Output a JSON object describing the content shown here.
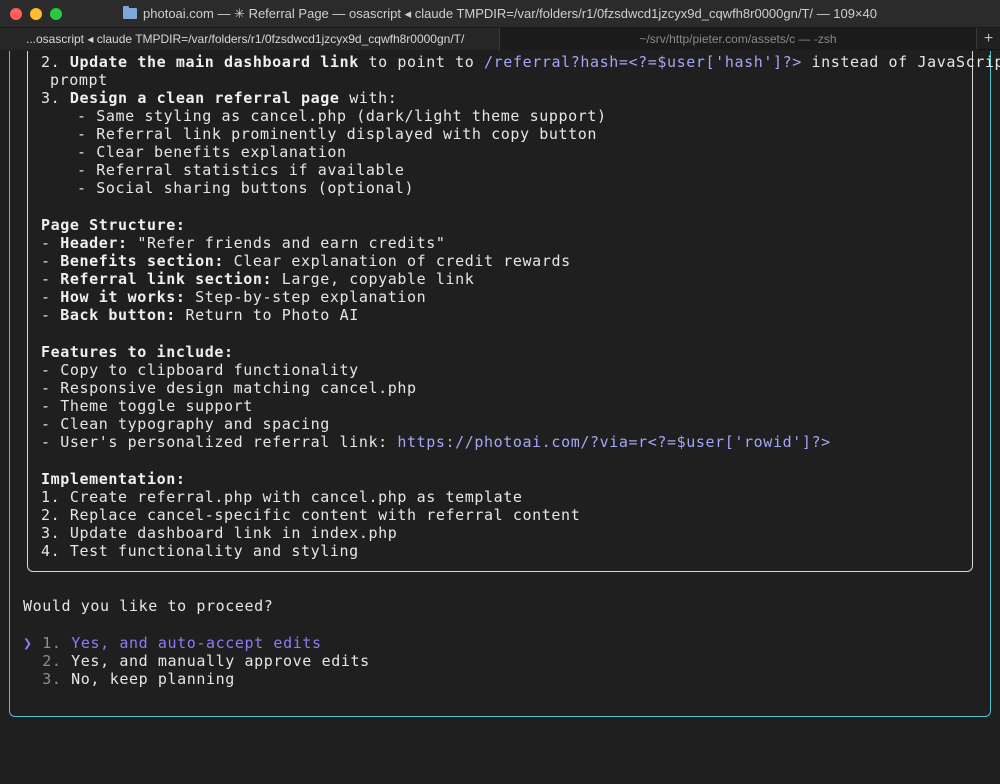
{
  "window": {
    "title": "photoai.com — ✳ Referral Page — osascript ◂ claude TMPDIR=/var/folders/r1/0fzsdwcd1jzcyx9d_cqwfh8r0000gn/T/ — 109×40"
  },
  "tabs": [
    {
      "label": "...osascript ◂ claude TMPDIR=/var/folders/r1/0fzsdwcd1jzcyx9d_cqwfh8r0000gn/T/"
    },
    {
      "label": "~/srv/http/pieter.com/assets/c — -zsh"
    }
  ],
  "tab_add_label": "+",
  "plan": {
    "step2_num": "2. ",
    "step2_bold": "Update the main dashboard link",
    "step2_mid": " to point to ",
    "step2_code": "/referral?hash=<?=$user['hash']?>",
    "step2_end": " instead of JavaScript",
    "step2_cont": "prompt",
    "step3_num": "3. ",
    "step3_bold": "Design a clean referral page",
    "step3_end": " with:",
    "step3_items": [
      "- Same styling as cancel.php (dark/light theme support)",
      "- Referral link prominently displayed with copy button",
      "- Clear benefits explanation",
      "- Referral statistics if available",
      "- Social sharing buttons (optional)"
    ],
    "structure_heading": "Page Structure:",
    "structure": [
      {
        "label": "Header:",
        "text": " \"Refer friends and earn credits\""
      },
      {
        "label": "Benefits section:",
        "text": " Clear explanation of credit rewards"
      },
      {
        "label": "Referral link section:",
        "text": " Large, copyable link"
      },
      {
        "label": "How it works:",
        "text": " Step-by-step explanation"
      },
      {
        "label": "Back button:",
        "text": " Return to Photo AI"
      }
    ],
    "features_heading": "Features to include:",
    "features": [
      "- Copy to clipboard functionality",
      "- Responsive design matching cancel.php",
      "- Theme toggle support",
      "- Clean typography and spacing"
    ],
    "features_last_text": "- User's personalized referral link: ",
    "features_last_code": "https://photoai.com/?via=r<?=$user['rowid']?>",
    "impl_heading": "Implementation:",
    "impl": [
      "1. Create referral.php with cancel.php as template",
      "2. Replace cancel-specific content with referral content",
      "3. Update dashboard link in index.php",
      "4. Test functionality and styling"
    ]
  },
  "prompt": {
    "question": "Would you like to proceed?",
    "pointer": "❯",
    "options": [
      {
        "num": "1.",
        "label": "Yes, and auto-accept edits"
      },
      {
        "num": "2.",
        "label": "Yes, and manually approve edits"
      },
      {
        "num": "3.",
        "label": "No, keep planning"
      }
    ]
  }
}
